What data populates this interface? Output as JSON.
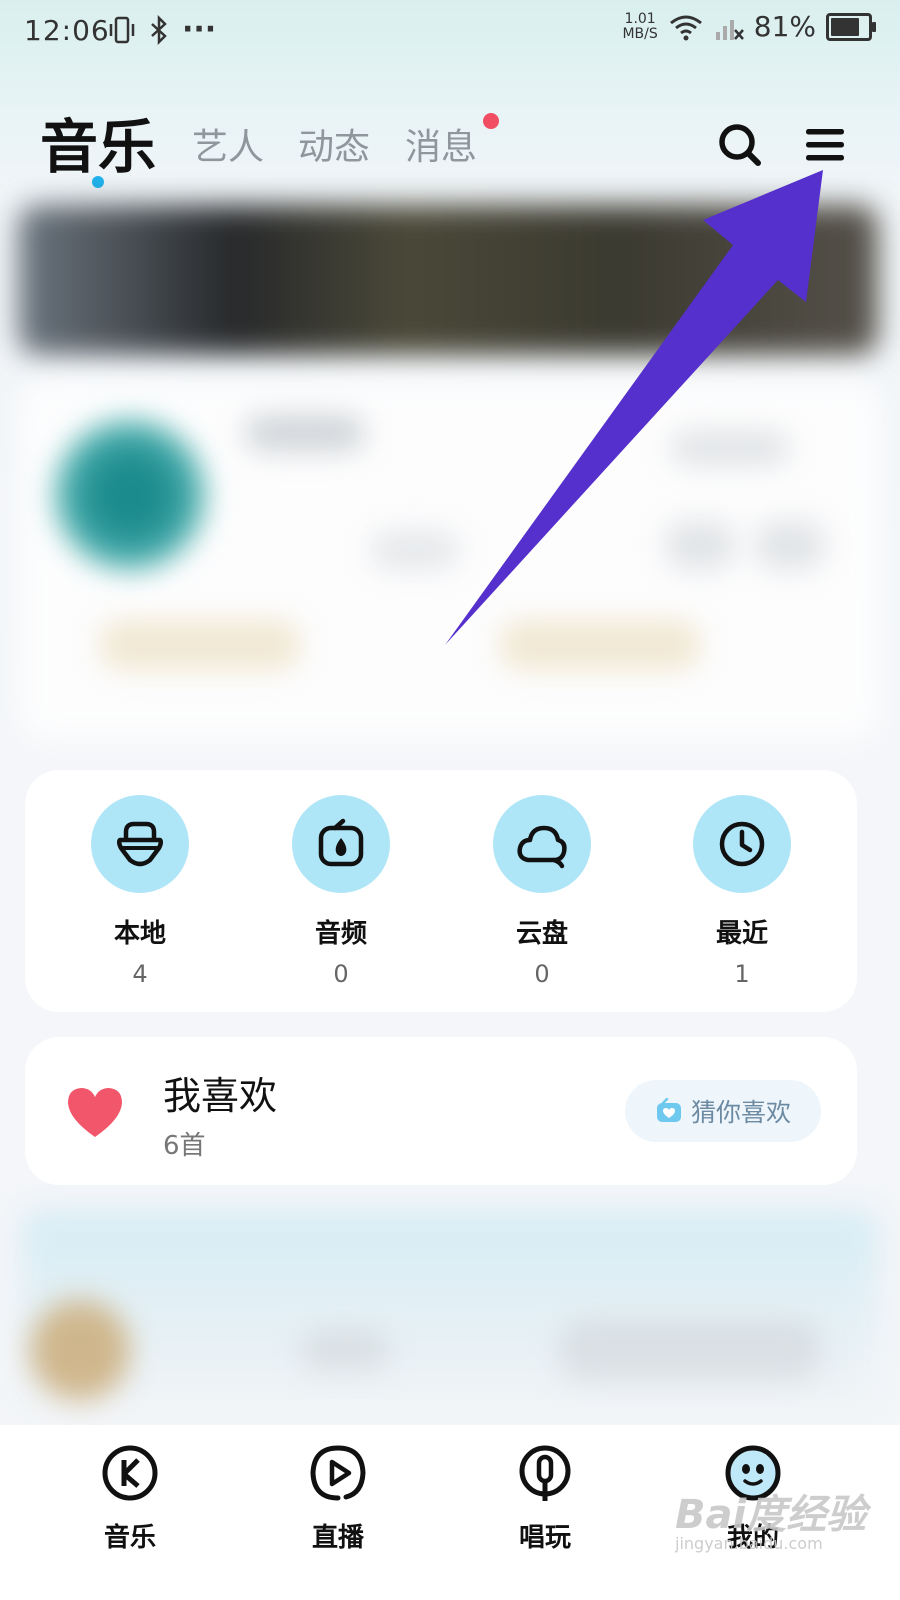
{
  "status_bar": {
    "time": "12:06",
    "dots": "···",
    "net_speed_value": "1.01",
    "net_speed_unit": "MB/S",
    "battery_percent": "81%",
    "battery_level": 0.81
  },
  "header": {
    "tabs": [
      {
        "label": "音乐",
        "active": true
      },
      {
        "label": "艺人",
        "active": false
      },
      {
        "label": "动态",
        "active": false
      },
      {
        "label": "消息",
        "active": false,
        "badge_dot": true
      }
    ],
    "icons": [
      "search-icon",
      "menu-icon"
    ]
  },
  "quick_access": [
    {
      "label": "本地",
      "count": "4",
      "icon": "local-music-icon"
    },
    {
      "label": "音频",
      "count": "0",
      "icon": "audio-icon"
    },
    {
      "label": "云盘",
      "count": "0",
      "icon": "cloud-disk-icon"
    },
    {
      "label": "最近",
      "count": "1",
      "icon": "clock-icon"
    }
  ],
  "favorites": {
    "title": "我喜欢",
    "subtitle": "6首",
    "guess_button": "猜你喜欢"
  },
  "bottom_nav": [
    {
      "label": "音乐",
      "icon": "k-music-icon"
    },
    {
      "label": "直播",
      "icon": "live-play-icon"
    },
    {
      "label": "唱玩",
      "icon": "microphone-icon"
    },
    {
      "label": "我的",
      "icon": "ghost-profile-icon",
      "active": true
    }
  ],
  "watermark": {
    "main": "Bai度经验",
    "sub": "jingyan.baidu.com"
  },
  "colors": {
    "accent_blue": "#1fb2ee",
    "badge_red": "#f14d63",
    "icon_bg": "#aee6f7",
    "heart": "#f2566a",
    "annotation_arrow": "#5530cc"
  }
}
